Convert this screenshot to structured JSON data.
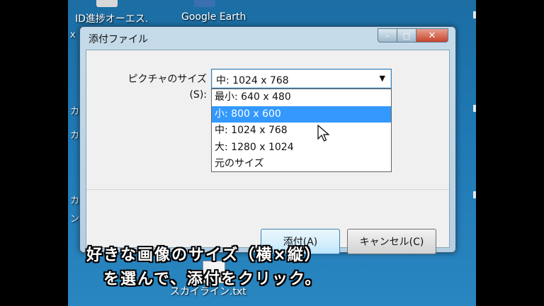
{
  "desktop": {
    "icons": [
      {
        "label": "ID進捗オーエス."
      },
      {
        "label": "Google Earth"
      }
    ],
    "edge_fragments": [
      "x",
      "カ",
      "カ",
      "カ",
      "ン"
    ],
    "file": {
      "label": "スカイライン.txt"
    }
  },
  "dialog": {
    "title": "添付ファイル",
    "buttons": {
      "minimize": "–",
      "maximize": "□",
      "close": "✕"
    },
    "size_label_line1": "ピクチャのサイズ",
    "size_label_line2": "(S):",
    "combo": {
      "value": "中: 1024 x 768",
      "arrow": "▼"
    },
    "options": [
      {
        "label": "最小: 640 x 480"
      },
      {
        "label": "小: 800 x 600"
      },
      {
        "label": "中: 1024 x 768"
      },
      {
        "label": "大: 1280 x 1024"
      },
      {
        "label": "元のサイズ"
      }
    ],
    "highlighted_option": "小: 800 x 600",
    "ok_label": "添付(A)",
    "cancel_label": "キャンセル(C)"
  },
  "caption": {
    "line1": "好きな画像のサイズ（横×縦）",
    "line2": "を選んで、添付をクリック。"
  },
  "colors": {
    "highlight": "#3399ff",
    "desktop": "#1f79b4",
    "close_button": "#c8432c"
  }
}
